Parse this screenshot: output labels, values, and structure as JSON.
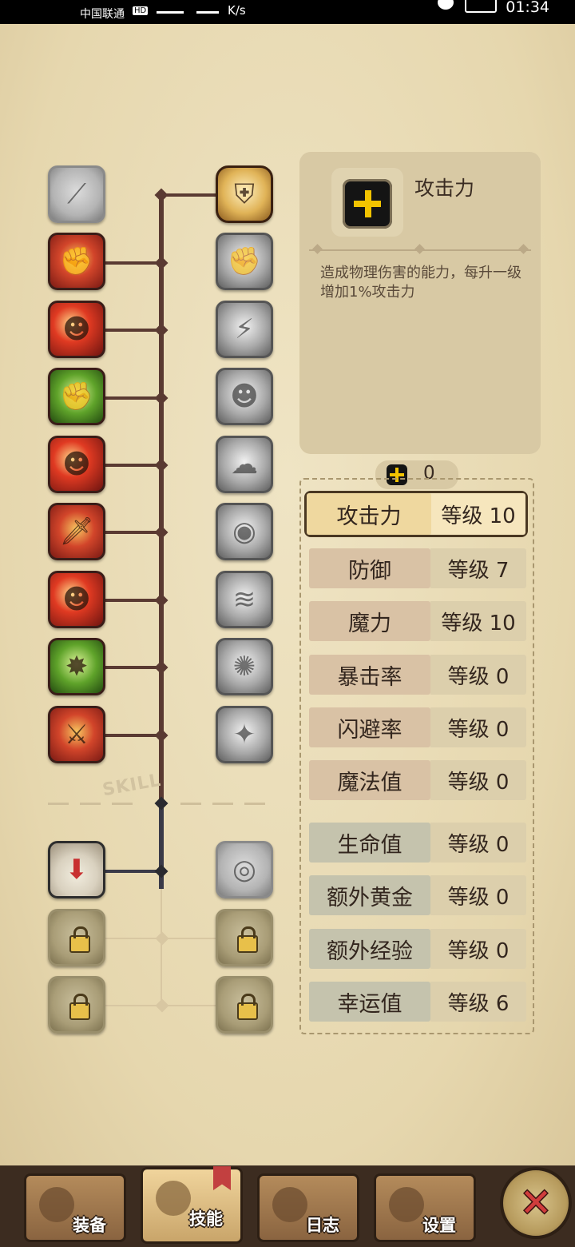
{
  "status_bar": {
    "carrier": "中国联通",
    "hd_badge": "HD",
    "net_speed": "K/s",
    "time": "01:34"
  },
  "skill_tree": {
    "section_label": "SKILL"
  },
  "detail": {
    "title": "攻击力",
    "description": "造成物理伤害的能力，每升一级增加1%攻击力"
  },
  "points": {
    "value": "0"
  },
  "stats": [
    {
      "name": "攻击力",
      "level": "等级 10"
    },
    {
      "name": "防御",
      "level": "等级 7"
    },
    {
      "name": "魔力",
      "level": "等级 10"
    },
    {
      "name": "暴击率",
      "level": "等级 0"
    },
    {
      "name": "闪避率",
      "level": "等级 0"
    },
    {
      "name": "魔法值",
      "level": "等级 0"
    },
    {
      "name": "生命值",
      "level": "等级 0"
    },
    {
      "name": "额外黄金",
      "level": "等级 0"
    },
    {
      "name": "额外经验",
      "level": "等级 0"
    },
    {
      "name": "幸运值",
      "level": "等级 6"
    }
  ],
  "bottom_nav": {
    "equip": "装备",
    "skills": "技能",
    "log": "日志",
    "settings": "设置"
  }
}
